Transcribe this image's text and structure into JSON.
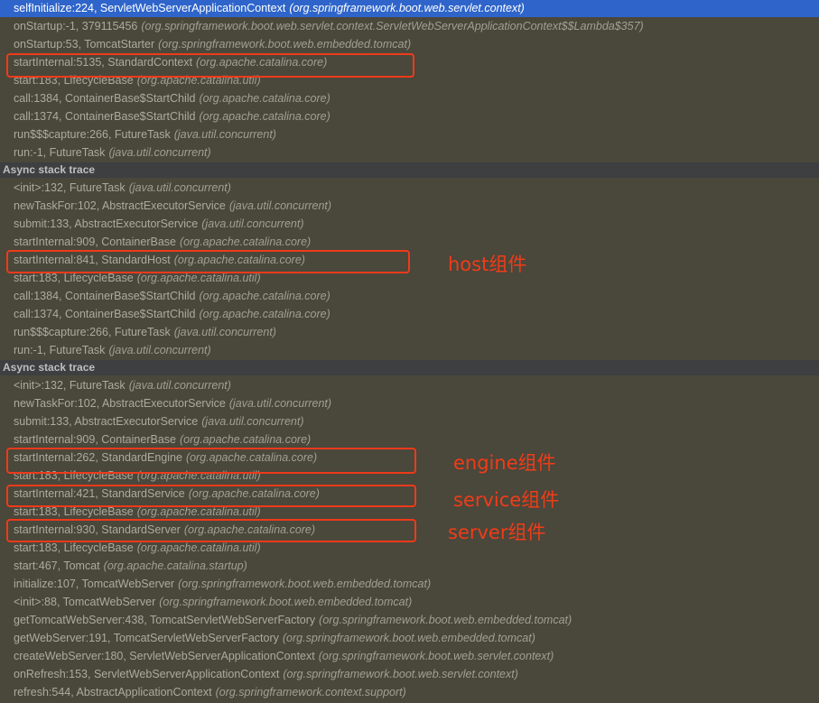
{
  "frames": [
    {
      "type": "frame",
      "method": "selfInitialize:224, ServletWebServerApplicationContext",
      "pkg": "(org.springframework.boot.web.servlet.context)",
      "selected": true
    },
    {
      "type": "frame",
      "method": "onStartup:-1, 379115456",
      "pkg": "(org.springframework.boot.web.servlet.context.ServletWebServerApplicationContext$$Lambda$357)"
    },
    {
      "type": "frame",
      "method": "onStartup:53, TomcatStarter",
      "pkg": "(org.springframework.boot.web.embedded.tomcat)"
    },
    {
      "type": "frame",
      "method": "startInternal:5135, StandardContext",
      "pkg": "(org.apache.catalina.core)"
    },
    {
      "type": "frame",
      "method": "start:183, LifecycleBase",
      "pkg": "(org.apache.catalina.util)"
    },
    {
      "type": "frame",
      "method": "call:1384, ContainerBase$StartChild",
      "pkg": "(org.apache.catalina.core)"
    },
    {
      "type": "frame",
      "method": "call:1374, ContainerBase$StartChild",
      "pkg": "(org.apache.catalina.core)"
    },
    {
      "type": "frame",
      "method": "run$$$capture:266, FutureTask",
      "pkg": "(java.util.concurrent)"
    },
    {
      "type": "frame",
      "method": "run:-1, FutureTask",
      "pkg": "(java.util.concurrent)"
    },
    {
      "type": "separator",
      "label": "Async stack trace"
    },
    {
      "type": "frame",
      "method": "<init>:132, FutureTask",
      "pkg": "(java.util.concurrent)"
    },
    {
      "type": "frame",
      "method": "newTaskFor:102, AbstractExecutorService",
      "pkg": "(java.util.concurrent)"
    },
    {
      "type": "frame",
      "method": "submit:133, AbstractExecutorService",
      "pkg": "(java.util.concurrent)"
    },
    {
      "type": "frame",
      "method": "startInternal:909, ContainerBase",
      "pkg": "(org.apache.catalina.core)"
    },
    {
      "type": "frame",
      "method": "startInternal:841, StandardHost",
      "pkg": "(org.apache.catalina.core)"
    },
    {
      "type": "frame",
      "method": "start:183, LifecycleBase",
      "pkg": "(org.apache.catalina.util)"
    },
    {
      "type": "frame",
      "method": "call:1384, ContainerBase$StartChild",
      "pkg": "(org.apache.catalina.core)"
    },
    {
      "type": "frame",
      "method": "call:1374, ContainerBase$StartChild",
      "pkg": "(org.apache.catalina.core)"
    },
    {
      "type": "frame",
      "method": "run$$$capture:266, FutureTask",
      "pkg": "(java.util.concurrent)"
    },
    {
      "type": "frame",
      "method": "run:-1, FutureTask",
      "pkg": "(java.util.concurrent)"
    },
    {
      "type": "separator",
      "label": "Async stack trace"
    },
    {
      "type": "frame",
      "method": "<init>:132, FutureTask",
      "pkg": "(java.util.concurrent)"
    },
    {
      "type": "frame",
      "method": "newTaskFor:102, AbstractExecutorService",
      "pkg": "(java.util.concurrent)"
    },
    {
      "type": "frame",
      "method": "submit:133, AbstractExecutorService",
      "pkg": "(java.util.concurrent)"
    },
    {
      "type": "frame",
      "method": "startInternal:909, ContainerBase",
      "pkg": "(org.apache.catalina.core)"
    },
    {
      "type": "frame",
      "method": "startInternal:262, StandardEngine",
      "pkg": "(org.apache.catalina.core)"
    },
    {
      "type": "frame",
      "method": "start:183, LifecycleBase",
      "pkg": "(org.apache.catalina.util)"
    },
    {
      "type": "frame",
      "method": "startInternal:421, StandardService",
      "pkg": "(org.apache.catalina.core)"
    },
    {
      "type": "frame",
      "method": "start:183, LifecycleBase",
      "pkg": "(org.apache.catalina.util)"
    },
    {
      "type": "frame",
      "method": "startInternal:930, StandardServer",
      "pkg": "(org.apache.catalina.core)"
    },
    {
      "type": "frame",
      "method": "start:183, LifecycleBase",
      "pkg": "(org.apache.catalina.util)"
    },
    {
      "type": "frame",
      "method": "start:467, Tomcat",
      "pkg": "(org.apache.catalina.startup)"
    },
    {
      "type": "frame",
      "method": "initialize:107, TomcatWebServer",
      "pkg": "(org.springframework.boot.web.embedded.tomcat)"
    },
    {
      "type": "frame",
      "method": "<init>:88, TomcatWebServer",
      "pkg": "(org.springframework.boot.web.embedded.tomcat)"
    },
    {
      "type": "frame",
      "method": "getTomcatWebServer:438, TomcatServletWebServerFactory",
      "pkg": "(org.springframework.boot.web.embedded.tomcat)"
    },
    {
      "type": "frame",
      "method": "getWebServer:191, TomcatServletWebServerFactory",
      "pkg": "(org.springframework.boot.web.embedded.tomcat)"
    },
    {
      "type": "frame",
      "method": "createWebServer:180, ServletWebServerApplicationContext",
      "pkg": "(org.springframework.boot.web.servlet.context)"
    },
    {
      "type": "frame",
      "method": "onRefresh:153, ServletWebServerApplicationContext",
      "pkg": "(org.springframework.boot.web.servlet.context)"
    },
    {
      "type": "frame",
      "method": "refresh:544, AbstractApplicationContext",
      "pkg": "(org.springframework.context.support)"
    }
  ],
  "annotations": {
    "host": "host组件",
    "engine": "engine组件",
    "service": "service组件",
    "server": "server组件"
  },
  "colors": {
    "selection": "#2f65ca",
    "highlight_border": "#ef3a1a",
    "annotation_text": "#f03c18",
    "background": "#4a473b"
  }
}
